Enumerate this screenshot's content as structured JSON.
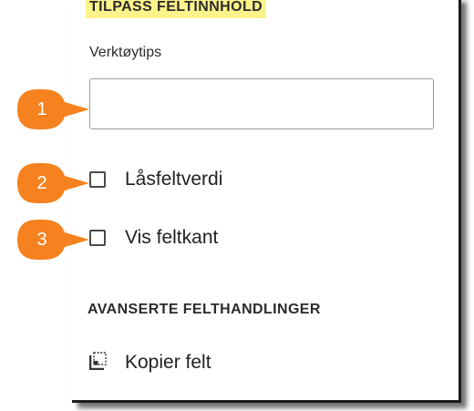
{
  "panel": {
    "section_title": "TILPASS FELTINNHOLD",
    "tooltip_label": "Verktøytips",
    "tooltip_value": "",
    "lock_value_label": "Låsfeltverdi",
    "show_border_label": "Vis feltkant",
    "advanced_title": "AVANSERTE FELTHANDLINGER",
    "copy_field_label": "Kopier felt"
  },
  "callouts": [
    "1",
    "2",
    "3"
  ],
  "colors": {
    "callout": "#f5821f",
    "highlight": "#fcf38a"
  }
}
